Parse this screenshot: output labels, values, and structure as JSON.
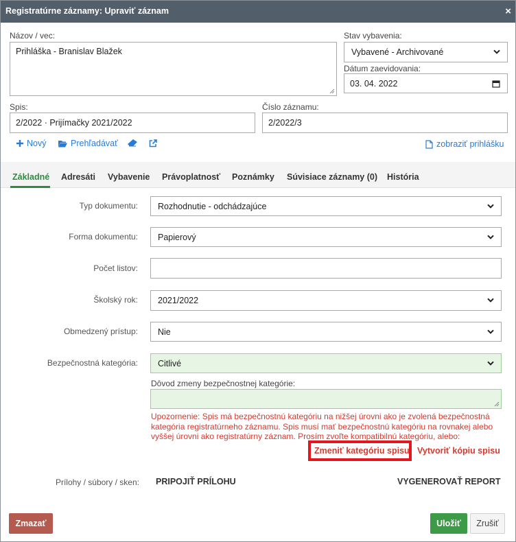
{
  "window": {
    "title": "Registratúrne záznamy: Upraviť záznam",
    "close_icon": "×"
  },
  "header": {
    "nazov_label": "Názov / vec:",
    "nazov_value": "Prihláška - Branislav Blažek",
    "stav_label": "Stav vybavenia:",
    "stav_value": "Vybavené - Archivované",
    "datum_label": "Dátum zaevidovania:",
    "datum_value": "03. 04. 2022",
    "spis_label": "Spis:",
    "spis_value": "2/2022 · Prijímačky 2021/2022",
    "cislo_label": "Číslo záznamu:",
    "cislo_value": "2/2022/3"
  },
  "toolbar": {
    "novy": "Nový",
    "prehladavat": "Prehľadávať",
    "zobrazit": "zobraziť prihlášku"
  },
  "tabs": [
    {
      "label": "Základné",
      "active": true
    },
    {
      "label": "Adresáti"
    },
    {
      "label": "Vybavenie"
    },
    {
      "label": "Právoplatnosť"
    },
    {
      "label": "Poznámky"
    },
    {
      "label": "Súvisiace záznamy (0)"
    },
    {
      "label": "História"
    }
  ],
  "form": {
    "typ_label": "Typ dokumentu:",
    "typ_value": "Rozhodnutie - odchádzajúce",
    "forma_label": "Forma dokumentu:",
    "forma_value": "Papierový",
    "pocet_label": "Počet listov:",
    "pocet_value": "",
    "rok_label": "Školský rok:",
    "rok_value": "2021/2022",
    "pristup_label": "Obmedzený prístup:",
    "pristup_value": "Nie",
    "kategoria_label": "Bezpečnostná kategória:",
    "kategoria_value": "Citlivé",
    "dovod_label": "Dôvod zmeny bezpečnostnej kategórie:",
    "dovod_value": "",
    "warning": "Upozornenie: Spis má bezpečnostnú kategóriu na nižšej úrovni ako je zvolená bezpečnostná kategória registratúrneho záznamu. Spis musí mať bezpečnostnú kategóriu na rovnakej alebo vyššej úrovni ako registratúrny záznam. Prosím zvoľte kompatibilnú kategóriu, alebo:",
    "zmenit_link": "Zmeniť kategóriu spisu",
    "vytvorit_link": "Vytvoriť kópiu spisu",
    "prilohy_label": "Prílohy / súbory / sken:",
    "pripojit": "PRIPOJIŤ PRÍLOHU",
    "vygenerovat": "VYGENEROVAŤ REPORT"
  },
  "footer": {
    "zmazat": "Zmazať",
    "ulozit": "Uložiť",
    "zrusit": "Zrušiť"
  },
  "colors": {
    "titlebar": "#525f6a",
    "accent_green": "#2e8a3e",
    "link_blue": "#2a7bd8",
    "danger": "#b55a4e",
    "warning_red": "#d43a2f",
    "highlight_red": "#e2181e"
  }
}
